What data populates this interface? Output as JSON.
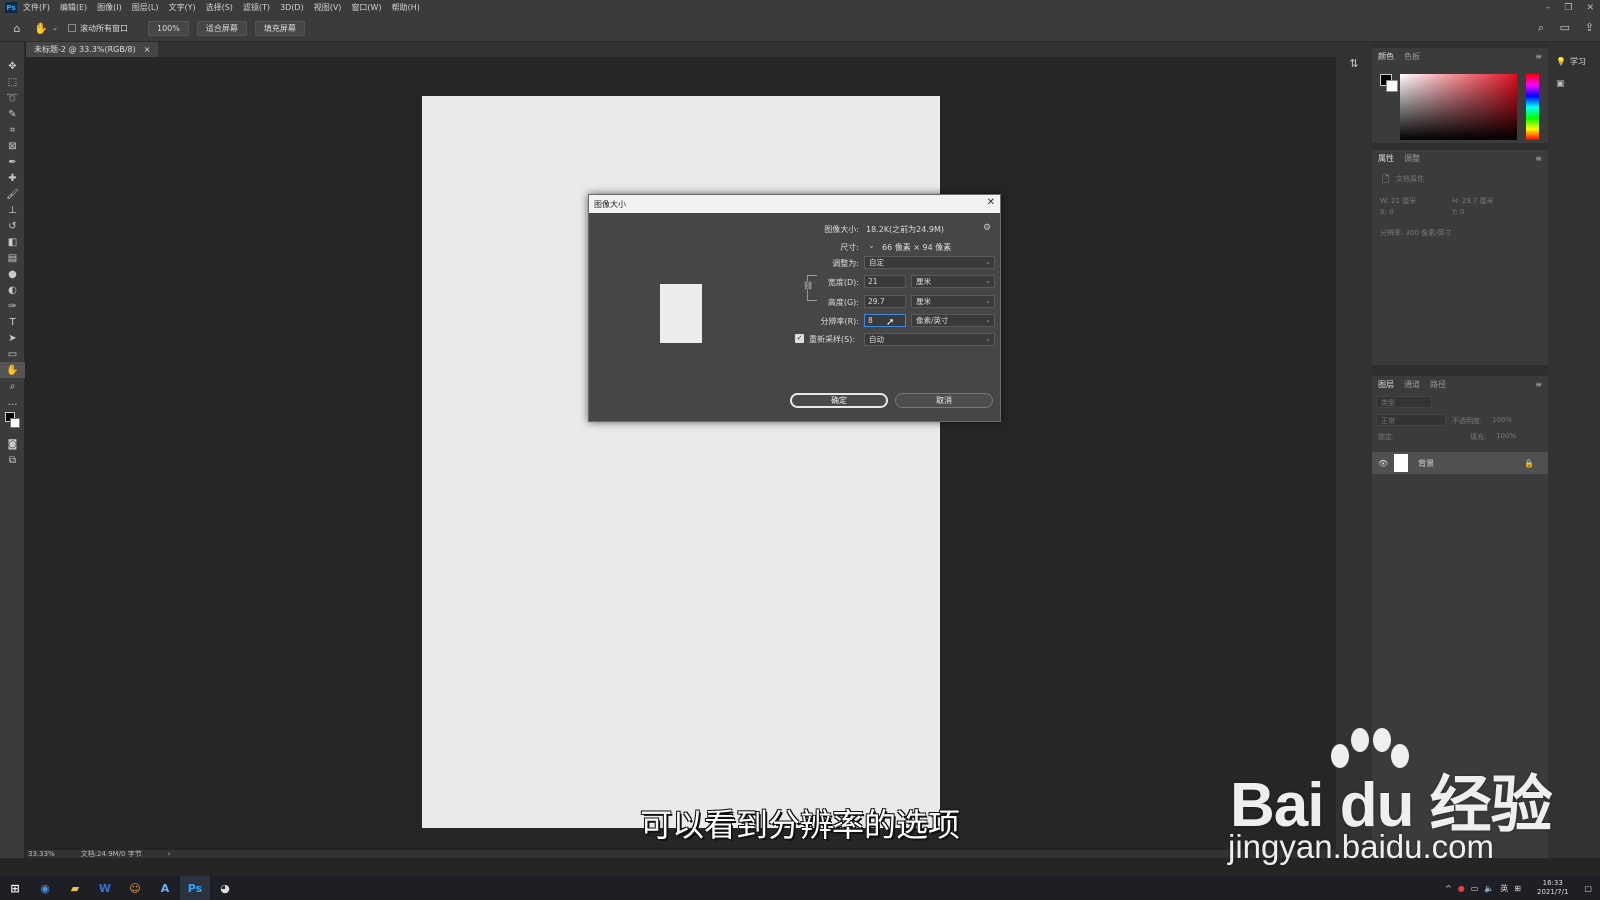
{
  "menubar": {
    "app_logo": "Ps",
    "items": [
      "文件(F)",
      "编辑(E)",
      "图像(I)",
      "图层(L)",
      "文字(Y)",
      "选择(S)",
      "滤镜(T)",
      "3D(D)",
      "视图(V)",
      "窗口(W)",
      "帮助(H)"
    ]
  },
  "options_bar": {
    "scroll_all_label": "滚动所有窗口",
    "zoom_btn": "100%",
    "fit_btn": "适合屏幕",
    "fill_btn": "填充屏幕"
  },
  "document": {
    "tab_title": "未标题-2 @ 33.3%(RGB/8)",
    "tab_close": "×"
  },
  "status_bar": {
    "zoom": "33.33%",
    "doc_info": "文档:24.9M/0 字节",
    "arrow": "›"
  },
  "panels": {
    "color_tabs": [
      "颜色",
      "色板"
    ],
    "props_tabs": [
      "属性",
      "调整"
    ],
    "props_doc_label": "文档属性",
    "props_w": "W: 21 厘米",
    "props_h": "H: 29.7 厘米",
    "props_x": "X: 0",
    "props_y": "Y: 0",
    "props_res": "分辨率: 300 像素/英寸",
    "layers_tabs": [
      "图层",
      "通道",
      "路径"
    ],
    "layers_kind": "类型",
    "layers_mode": "正常",
    "layers_opacity_label": "不透明度:",
    "layers_opacity": "100%",
    "layers_lock_label": "锁定:",
    "layers_fill_label": "填充:",
    "layers_fill": "100%",
    "layer_name": "背景",
    "learn_label": "学习"
  },
  "dialog": {
    "title": "图像大小",
    "size_label": "图像大小:",
    "size_value": "18.2K(之前为24.9M)",
    "dims_label": "尺寸:",
    "dims_value": "66 像素 × 94 像素",
    "fit_label": "调整为:",
    "fit_value": "自定",
    "width_label": "宽度(D):",
    "width_value": "21",
    "width_unit": "厘米",
    "height_label": "高度(G):",
    "height_value": "29.7",
    "height_unit": "厘米",
    "res_label": "分辨率(R):",
    "res_value": "8",
    "res_unit": "像素/英寸",
    "resample_label": "重新采样(S):",
    "resample_value": "自动",
    "ok": "确定",
    "cancel": "取消",
    "close": "✕"
  },
  "overlay": {
    "subtitle": "可以看到分辨率的选项",
    "watermark_brand": "Bai du 经验",
    "watermark_url": "jingyan.baidu.com"
  },
  "taskbar": {
    "tray_lang": "英",
    "time": "16:33",
    "date": "2021/7/1"
  },
  "colors": {
    "accent_blue": "#31a8ff",
    "panel_bg": "#3b3b3b",
    "canvas_bg": "#262626"
  }
}
